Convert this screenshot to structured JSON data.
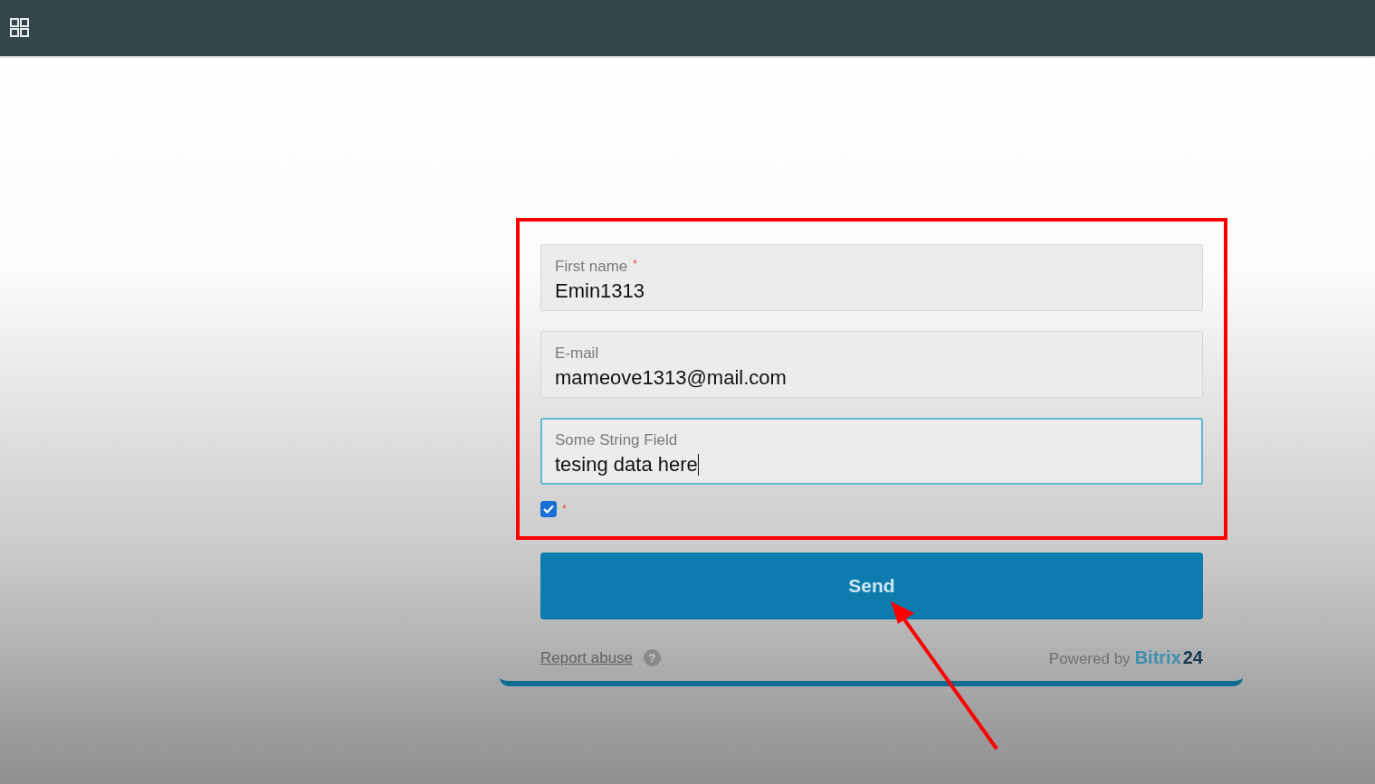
{
  "fields": [
    {
      "label": "First name",
      "required_mark": "*",
      "value": "Emin1313",
      "focused": false
    },
    {
      "label": "E-mail",
      "value": "mameove1313@mail.com",
      "focused": false
    },
    {
      "label": "Some String Field",
      "value": "tesing data here",
      "focused": true
    }
  ],
  "consent": {
    "checked": true,
    "required_mark": "*"
  },
  "submit": {
    "label": "Send"
  },
  "footer": {
    "report_link": "Report abuse",
    "help_icon": "?",
    "powered_by": "Powered by",
    "brand": "Bitrix",
    "brand_number": "24"
  }
}
